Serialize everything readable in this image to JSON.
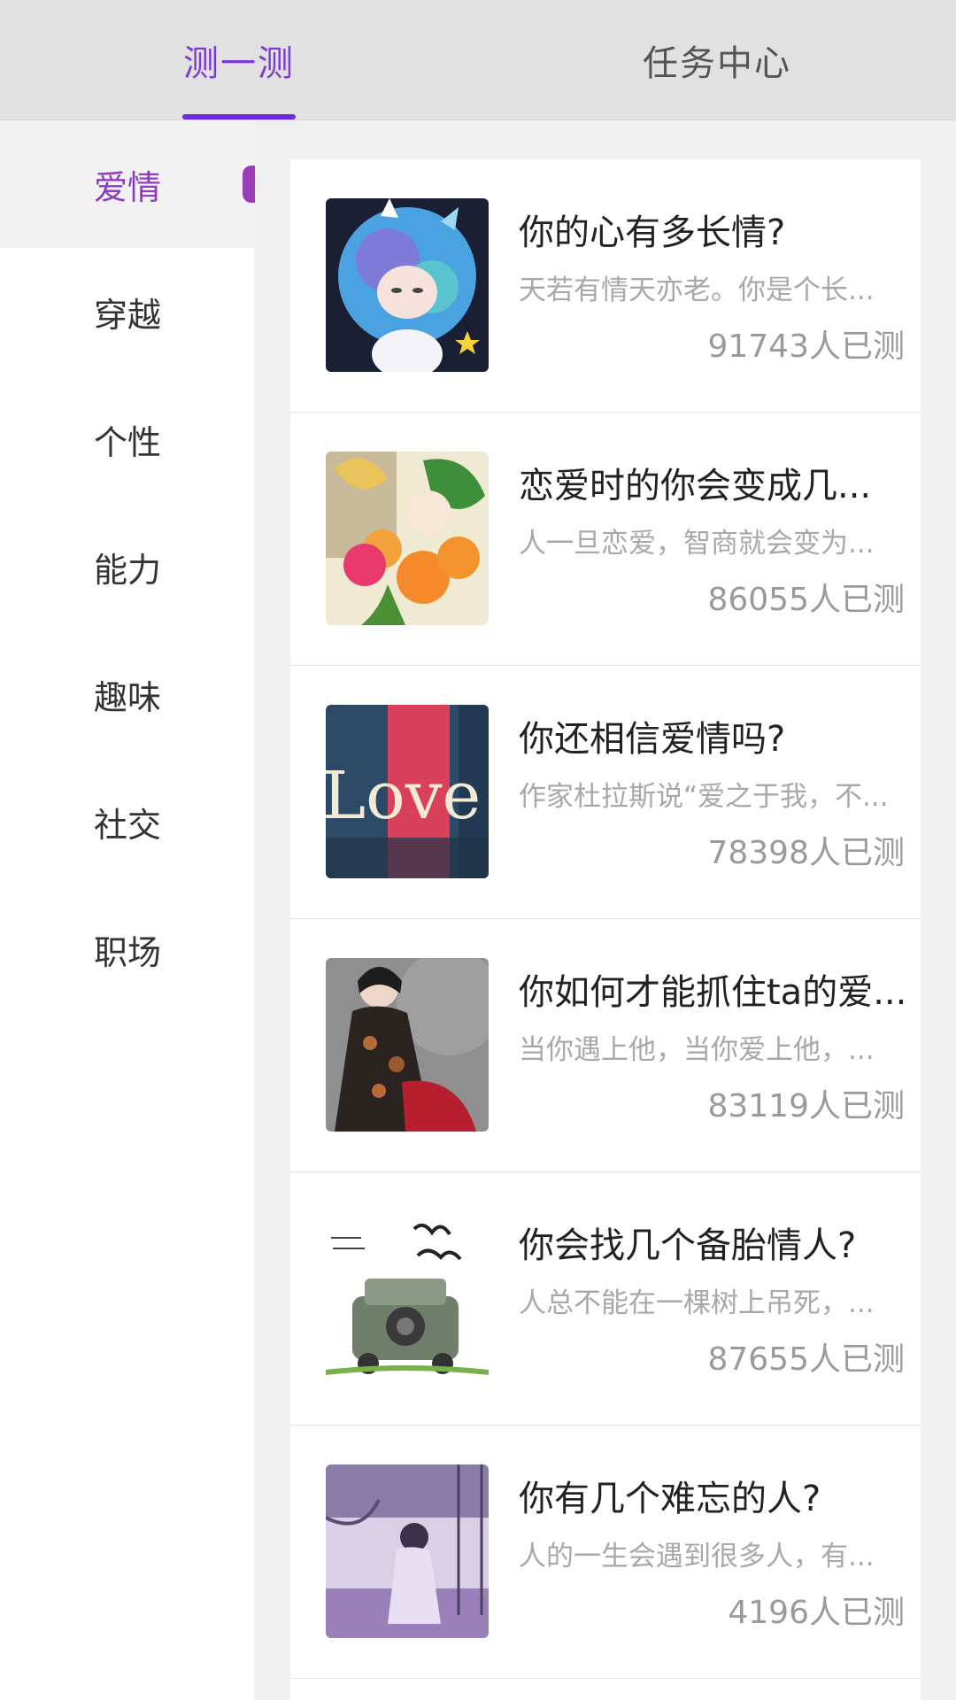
{
  "tabs": [
    {
      "label": "测一测",
      "active": true
    },
    {
      "label": "任务中心",
      "active": false
    }
  ],
  "sidebar": {
    "items": [
      {
        "label": "爱情",
        "active": true
      },
      {
        "label": "穿越",
        "active": false
      },
      {
        "label": "个性",
        "active": false
      },
      {
        "label": "能力",
        "active": false
      },
      {
        "label": "趣味",
        "active": false
      },
      {
        "label": "社交",
        "active": false
      },
      {
        "label": "职场",
        "active": false
      }
    ]
  },
  "tests": [
    {
      "title": "你的心有多长情?",
      "desc": "天若有情天亦老。你是个长...",
      "count": "91743人已测",
      "thumb": "cartoon-girl-icon"
    },
    {
      "title": "恋爱时的你会变成几...",
      "desc": "人一旦恋爱，智商就会变为...",
      "count": "86055人已测",
      "thumb": "flowers-icon"
    },
    {
      "title": "你还相信爱情吗?",
      "desc": "作家杜拉斯说“爱之于我，不...",
      "count": "78398人已测",
      "thumb": "love-sign-icon"
    },
    {
      "title": "你如何才能抓住ta的爱...",
      "desc": "当你遇上他，当你爱上他，...",
      "count": "83119人已测",
      "thumb": "woman-portrait-icon"
    },
    {
      "title": "你会找几个备胎情人?",
      "desc": "人总不能在一棵树上吊死，...",
      "count": "87655人已测",
      "thumb": "jeep-sketch-icon"
    },
    {
      "title": "你有几个难忘的人?",
      "desc": "人的一生会遇到很多人，有...",
      "count": "4196人已测",
      "thumb": "swing-girl-icon"
    }
  ],
  "colors": {
    "accent": "#7e3bd4",
    "sidebar_active": "#8c3cbe",
    "tab_bg": "#e1e1e1"
  }
}
